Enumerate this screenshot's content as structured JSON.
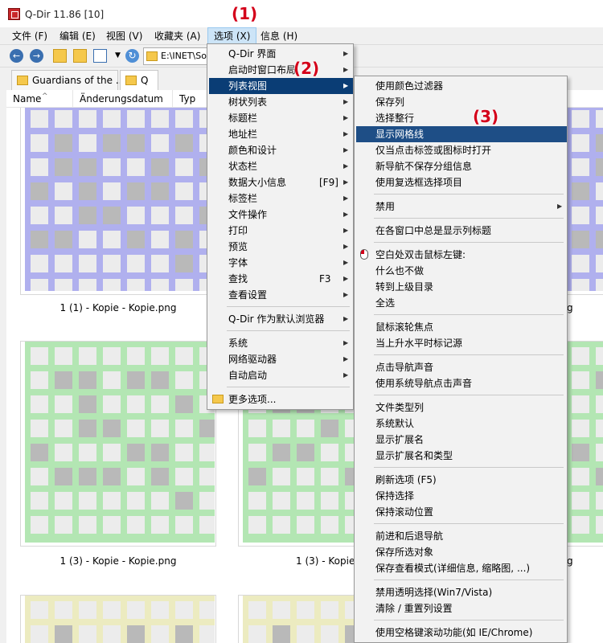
{
  "window": {
    "title": "Q-Dir 11.86 [10]"
  },
  "annotations": [
    "(1)",
    "(2)",
    "(3)"
  ],
  "menubar": [
    {
      "label": "文件 (F)"
    },
    {
      "label": "编辑 (E)"
    },
    {
      "label": "视图 (V)"
    },
    {
      "label": "收藏夹 (A)"
    },
    {
      "label": "选项 (X)"
    },
    {
      "label": "信息 (H)"
    }
  ],
  "toolbar": {
    "address": "E:\\INET\\So"
  },
  "tabs": [
    {
      "label": "Guardians of the ..."
    },
    {
      "label": "Q"
    }
  ],
  "columns": [
    "Name",
    "Änderungsdatum",
    "Typ"
  ],
  "thumbnails": [
    {
      "caption": "1 (1) - Kopie - Kopie.png",
      "color": "#b0b0ee",
      "light": "#d0d0f5"
    },
    {
      "caption": "1 (3) - Kopie - Kopie.png",
      "color": "#b3e6b3",
      "light": "#d2f0d2"
    },
    {
      "caption": "1 (3) - Kopie",
      "color": "#b3e6b3",
      "light": "#d2f0d2"
    },
    {
      "caption": "",
      "color": "#ecebc0",
      "light": "#f4f3d8"
    }
  ],
  "partial_captions": [
    "g",
    "g"
  ],
  "options_menu": {
    "items": [
      {
        "label": "Q-Dir 界面",
        "submenu": true
      },
      {
        "label": "启动时窗口布局",
        "submenu": true
      },
      {
        "label": "列表视图",
        "submenu": true,
        "highlighted": true
      },
      {
        "label": "树状列表",
        "submenu": true
      },
      {
        "label": "标题栏",
        "submenu": true
      },
      {
        "label": "地址栏",
        "submenu": true
      },
      {
        "label": "颜色和设计",
        "submenu": true
      },
      {
        "label": "状态栏",
        "submenu": true
      },
      {
        "label": "数据大小信息",
        "shortcut": "[F9]",
        "submenu": true
      },
      {
        "label": "标签栏",
        "submenu": true
      },
      {
        "label": "文件操作",
        "submenu": true
      },
      {
        "label": "打印",
        "submenu": true
      },
      {
        "label": "预览",
        "submenu": true
      },
      {
        "label": "字体",
        "submenu": true
      },
      {
        "label": "查找",
        "shortcut": "F3",
        "submenu": true
      },
      {
        "label": "查看设置",
        "submenu": true
      },
      {
        "separator": true
      },
      {
        "label": "Q-Dir 作为默认浏览器",
        "submenu": true
      },
      {
        "separator": true
      },
      {
        "label": "系统",
        "submenu": true
      },
      {
        "label": "网络驱动器",
        "submenu": true
      },
      {
        "label": "自动启动",
        "submenu": true
      },
      {
        "separator": true
      },
      {
        "label": "更多选项...",
        "icon": "folder-icon"
      }
    ]
  },
  "listview_submenu": {
    "items": [
      {
        "label": "使用颜色过滤器"
      },
      {
        "label": "保存列"
      },
      {
        "label": "选择整行"
      },
      {
        "label": "显示网格线",
        "highlighted": true
      },
      {
        "label": "仅当点击标签或图标时打开"
      },
      {
        "label": "新导航不保存分组信息"
      },
      {
        "label": "使用复选框选择项目"
      },
      {
        "separator": true
      },
      {
        "label": "禁用",
        "submenu": true
      },
      {
        "separator": true
      },
      {
        "label": "在各窗口中总是显示列标题"
      },
      {
        "separator": true
      },
      {
        "label": "空白处双击鼠标左键:",
        "icon": "mouse-icon"
      },
      {
        "label": "什么也不做"
      },
      {
        "label": "转到上级目录"
      },
      {
        "label": "全选"
      },
      {
        "separator": true
      },
      {
        "label": "鼠标滚轮焦点"
      },
      {
        "label": "当上升水平时标记源"
      },
      {
        "separator": true
      },
      {
        "label": "点击导航声音"
      },
      {
        "label": "使用系统导航点击声音"
      },
      {
        "separator": true
      },
      {
        "label": "文件类型列"
      },
      {
        "label": "系统默认"
      },
      {
        "label": "显示扩展名"
      },
      {
        "label": "显示扩展名和类型"
      },
      {
        "separator": true
      },
      {
        "label": "刷新选项 (F5)"
      },
      {
        "label": "保持选择"
      },
      {
        "label": "保持滚动位置"
      },
      {
        "separator": true
      },
      {
        "label": "前进和后退导航"
      },
      {
        "label": "保存所选对象"
      },
      {
        "label": "保存查看模式(详细信息, 缩略图, ...)"
      },
      {
        "separator": true
      },
      {
        "label": "禁用透明选择(Win7/Vista)"
      },
      {
        "label": "清除 / 重置列设置"
      },
      {
        "separator": true
      },
      {
        "label": "使用空格键滚动功能(如 IE/Chrome)"
      }
    ]
  }
}
